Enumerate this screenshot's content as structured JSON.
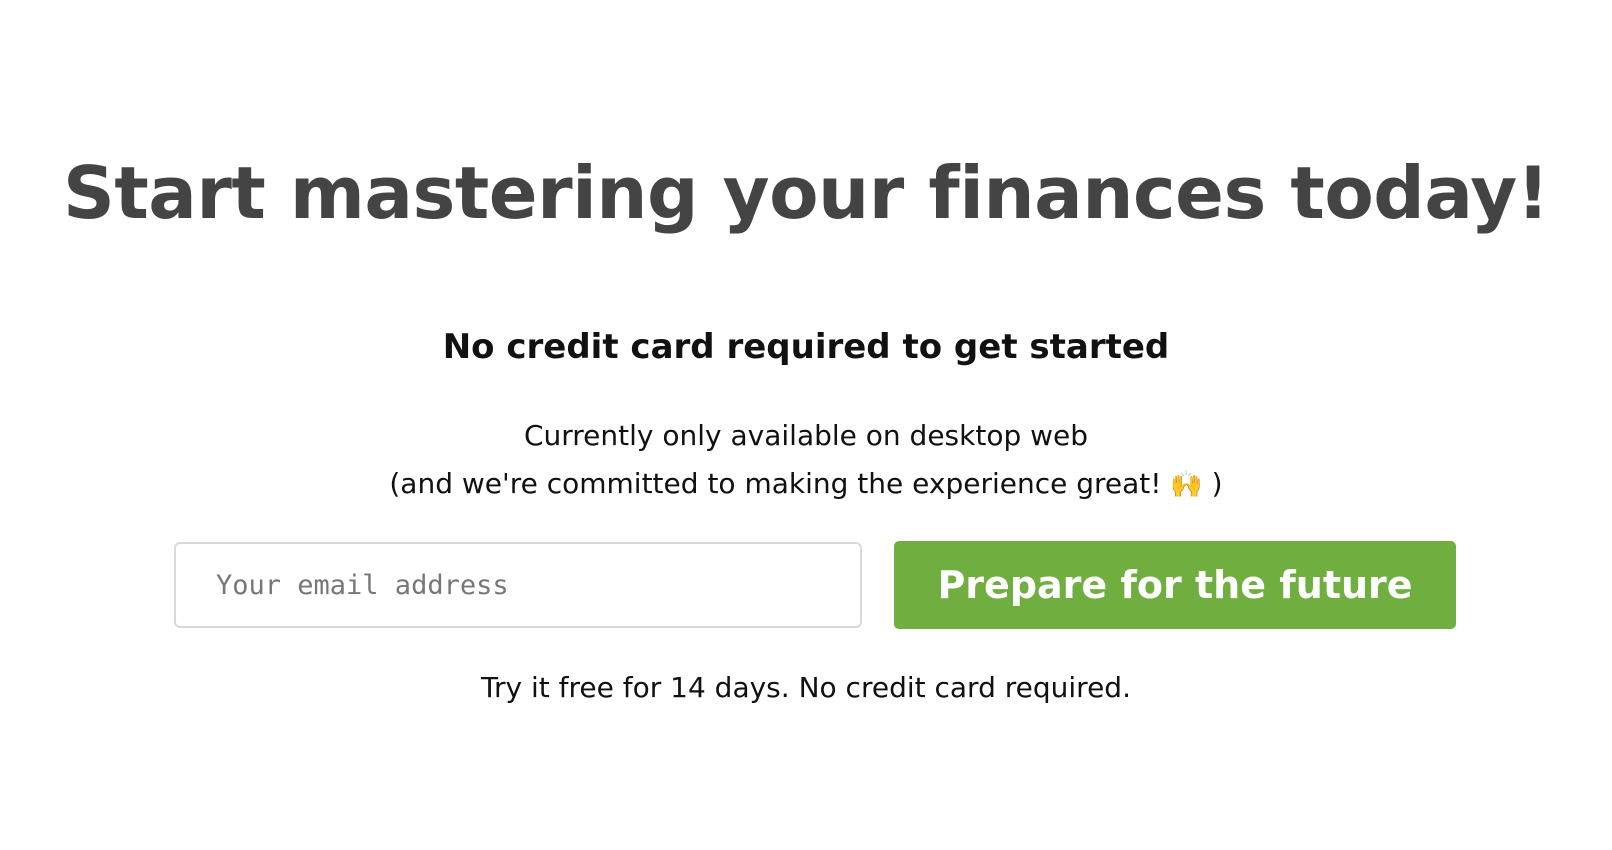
{
  "hero": {
    "headline": "Start mastering your finances today!",
    "subheadline": "No credit card required to get started",
    "availability_line1": "Currently only available on desktop web",
    "availability_line2_text": "(and we're committed to making the experience great! ",
    "availability_line2_emoji": "🙌",
    "availability_line2_end": " )"
  },
  "signup": {
    "email_placeholder": "Your email address",
    "email_value": "",
    "cta_label": "Prepare for the future",
    "cta_color": "#6fae3f"
  },
  "footer_note": "Try it free for 14 days. No credit card required.",
  "colors": {
    "headline": "#444444",
    "body_text": "#111111",
    "input_border": "#d9d9d9"
  }
}
